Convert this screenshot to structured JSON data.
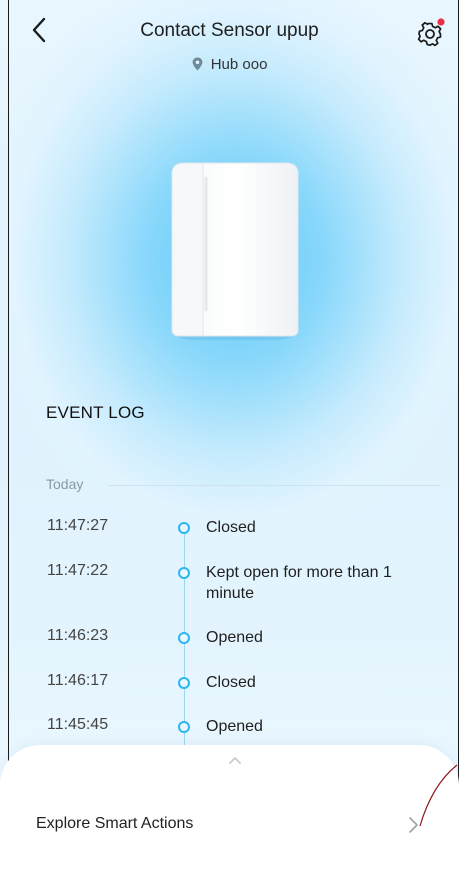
{
  "header": {
    "title": "Contact Sensor upup",
    "location": "Hub ooo",
    "back_icon": "chevron-left-icon",
    "settings_icon": "gear-icon",
    "settings_badge_color": "#e8304a"
  },
  "device": {
    "image": "contact-sensor-image"
  },
  "event_log": {
    "title": "EVENT LOG",
    "day": "Today",
    "events": [
      {
        "time": "11:47:27",
        "text": "Closed"
      },
      {
        "time": "11:47:22",
        "text": "Kept open for more than 1 minute"
      },
      {
        "time": "11:46:23",
        "text": "Opened"
      },
      {
        "time": "11:46:17",
        "text": "Closed"
      },
      {
        "time": "11:45:45",
        "text": "Opened"
      }
    ]
  },
  "bottom_sheet": {
    "handle_icon": "chevron-up-icon",
    "explore_label": "Explore Smart Actions",
    "explore_icon": "chevron-right-icon"
  },
  "colors": {
    "accent": "#2cb6f0",
    "background": "#e3f4fe"
  }
}
